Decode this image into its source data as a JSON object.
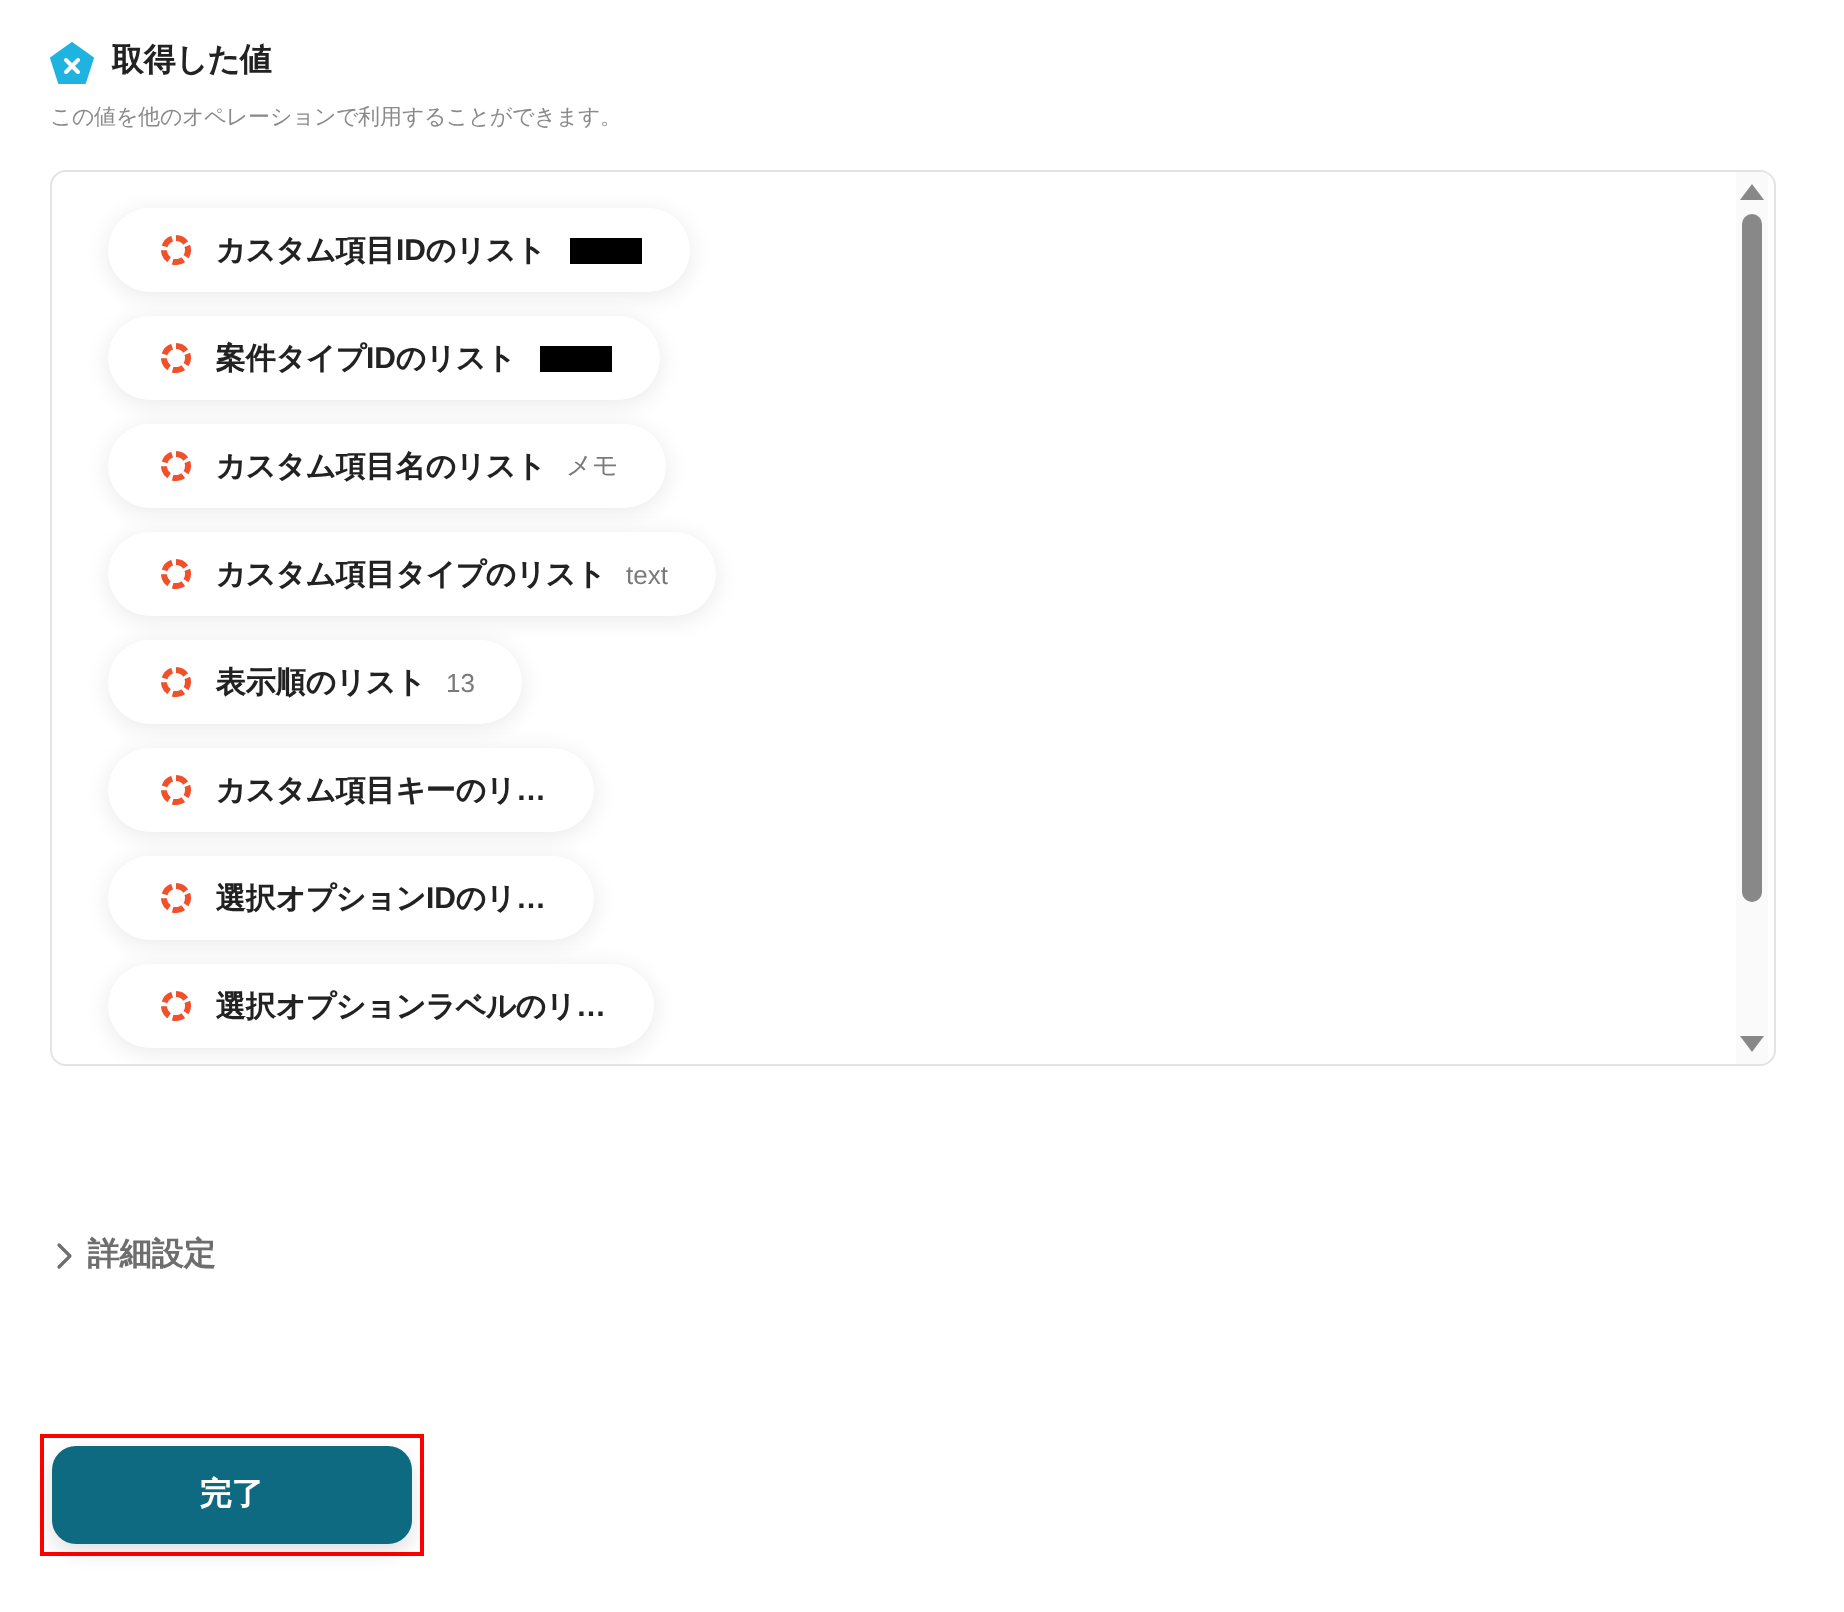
{
  "header": {
    "title": "取得した値",
    "description": "この値を他のオペレーションで利用することができます。"
  },
  "values_panel": {
    "items": [
      {
        "label": "カスタム項目IDのリスト",
        "redacted": true
      },
      {
        "label": "案件タイプIDのリスト",
        "redacted": true
      },
      {
        "label": "カスタム項目名のリスト",
        "redacted": false,
        "value": "メモ"
      },
      {
        "label": "カスタム項目タイプのリスト",
        "redacted": false,
        "value": "text"
      },
      {
        "label": "表示順のリスト",
        "redacted": false,
        "value": "13"
      },
      {
        "label": "カスタム項目キーのリ…",
        "redacted": false
      },
      {
        "label": "選択オプションIDのリ…",
        "redacted": false
      },
      {
        "label": "選択オプションラベルのリ…",
        "redacted": false
      }
    ]
  },
  "details_toggle": {
    "label": "詳細設定",
    "expanded": false
  },
  "done_button": {
    "label": "完了",
    "highlighted": true
  }
}
